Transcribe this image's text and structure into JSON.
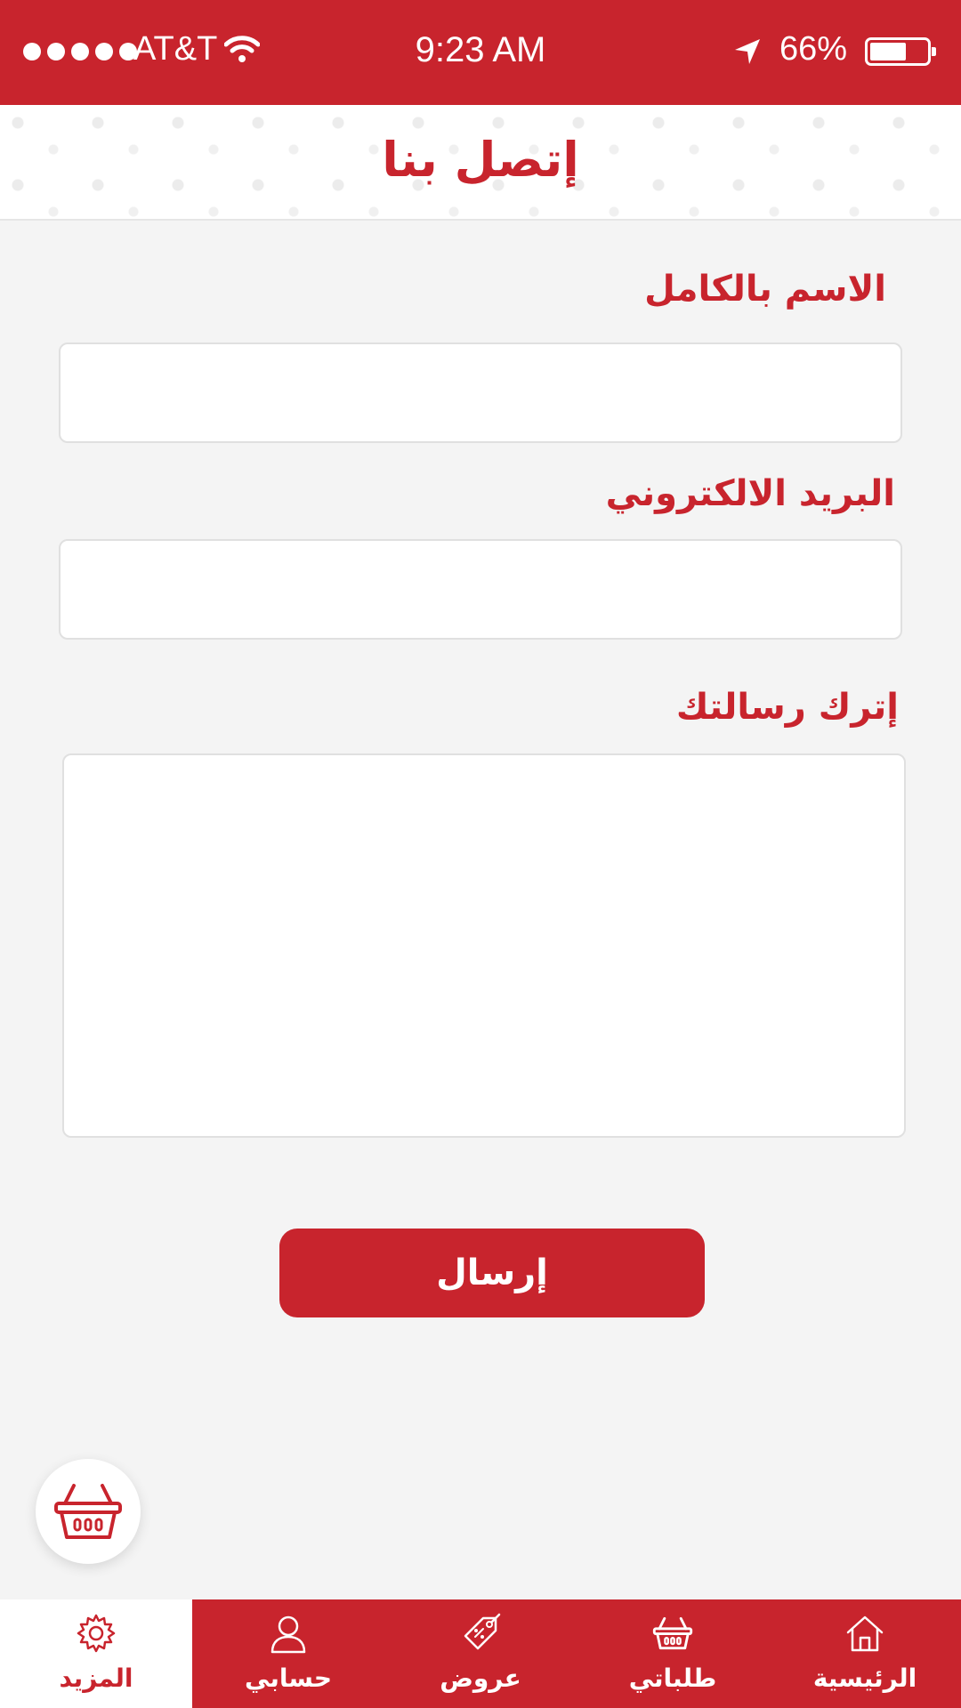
{
  "status_bar": {
    "carrier": "AT&T",
    "time": "9:23 AM",
    "battery": "66%",
    "battery_level": 0.66
  },
  "header": {
    "title": "إتصل بنا"
  },
  "form": {
    "name_label": "الاسم بالكامل",
    "name_value": "",
    "email_label": "البريد الالكتروني",
    "email_value": "",
    "message_label": "إترك رسالتك",
    "message_value": "",
    "submit_label": "إرسال"
  },
  "fab": {
    "icon": "basket-icon"
  },
  "tabbar": {
    "items": [
      {
        "label": "المزيد",
        "icon": "gear-icon",
        "active": true
      },
      {
        "label": "حسابي",
        "icon": "user-icon",
        "active": false
      },
      {
        "label": "عروض",
        "icon": "tag-icon",
        "active": false
      },
      {
        "label": "طلباتي",
        "icon": "basket-icon",
        "active": false
      },
      {
        "label": "الرئيسية",
        "icon": "home-icon",
        "active": false
      }
    ]
  },
  "colors": {
    "accent": "#c8242d",
    "background": "#f4f4f4"
  }
}
